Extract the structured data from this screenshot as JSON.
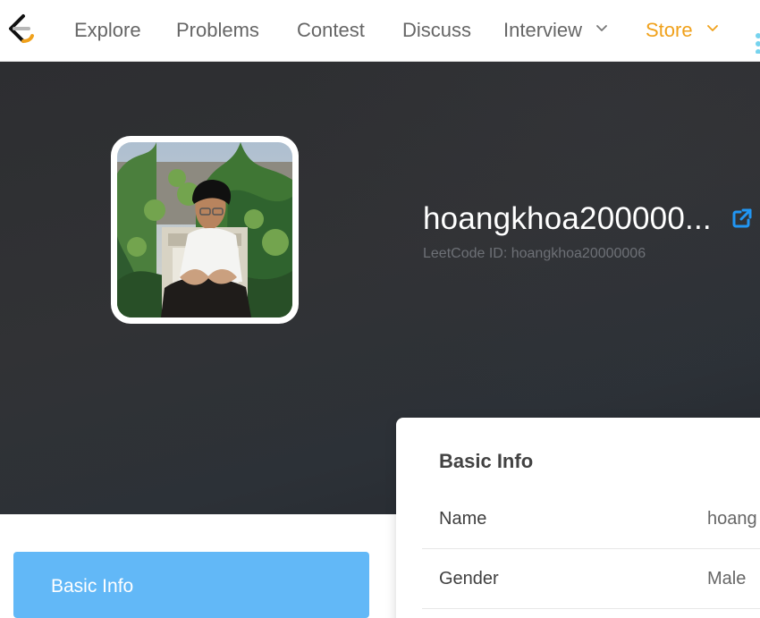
{
  "nav": {
    "items": [
      {
        "label": "Explore"
      },
      {
        "label": "Problems"
      },
      {
        "label": "Contest"
      },
      {
        "label": "Discuss"
      },
      {
        "label": "Interview"
      },
      {
        "label": "Store"
      }
    ]
  },
  "profile": {
    "username": "hoangkhoa200000...",
    "leetcode_id": "LeetCode ID: hoangkhoa20000006"
  },
  "basic_info": {
    "title": "Basic Info",
    "rows": [
      {
        "label": "Name",
        "value": "hoang"
      },
      {
        "label": "Gender",
        "value": "Male"
      }
    ]
  },
  "section_tab": {
    "label": "Basic Info"
  },
  "icons": {
    "logo": "leetcode-logo",
    "dropdown": "chevron-down-icon",
    "external_link": "external-link-icon"
  },
  "colors": {
    "nav_text": "#666666",
    "store_accent": "#f0a11b",
    "hero_background": "#2d2e31",
    "link_blue": "#2196f3",
    "tab_blue": "#62b8f7"
  }
}
